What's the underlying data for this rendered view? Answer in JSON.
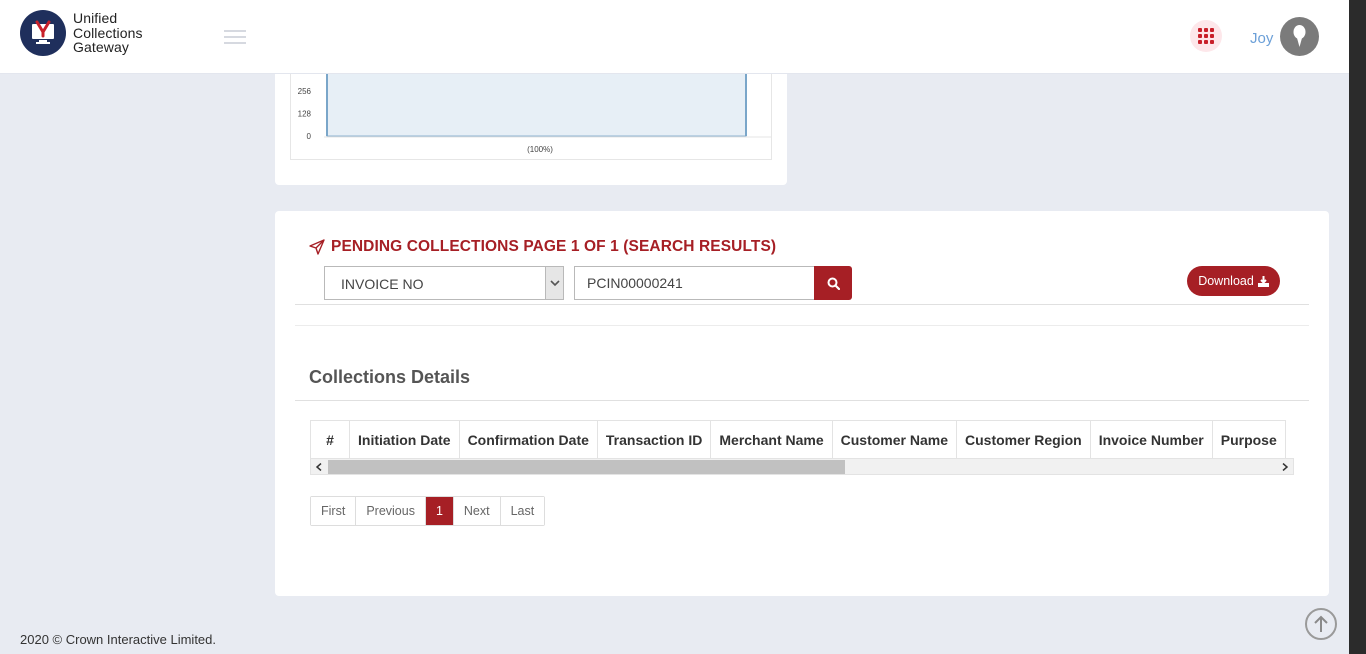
{
  "header": {
    "logo_line1": "Unified",
    "logo_line2": "Collections",
    "logo_line3": "Gateway",
    "user_name": "Joy"
  },
  "chart_data": {
    "type": "bar",
    "categories": [
      "(100%)"
    ],
    "values": [
      384
    ],
    "yticks": [
      0,
      128,
      256
    ],
    "title": "",
    "xlabel": "",
    "ylabel": ""
  },
  "collections": {
    "title": "PENDING COLLECTIONS PAGE 1 OF 1 (SEARCH RESULTS)",
    "filter_selected": "INVOICE NO",
    "search_value": "PCIN00000241",
    "download_label": "Download",
    "details_title": "Collections Details",
    "columns": [
      "#",
      "Initiation Date",
      "Confirmation Date",
      "Transaction ID",
      "Merchant Name",
      "Customer Name",
      "Customer Region",
      "Invoice Number",
      "Purpose"
    ],
    "pagination": [
      "First",
      "Previous",
      "1",
      "Next",
      "Last"
    ]
  },
  "footer": {
    "copyright": "2020 © Crown Interactive Limited."
  },
  "colors": {
    "brand_red": "#a61f25",
    "brand_navy": "#1f2f5c",
    "page_bg": "#e8ebf2"
  },
  "icons": [
    "logo-icon",
    "hamburger-icon",
    "apps-grid-icon",
    "user-avatar-icon",
    "paper-plane-icon",
    "chevron-down-icon",
    "search-icon",
    "download-icon",
    "chevron-left-icon",
    "chevron-right-icon",
    "arrow-up-icon"
  ]
}
